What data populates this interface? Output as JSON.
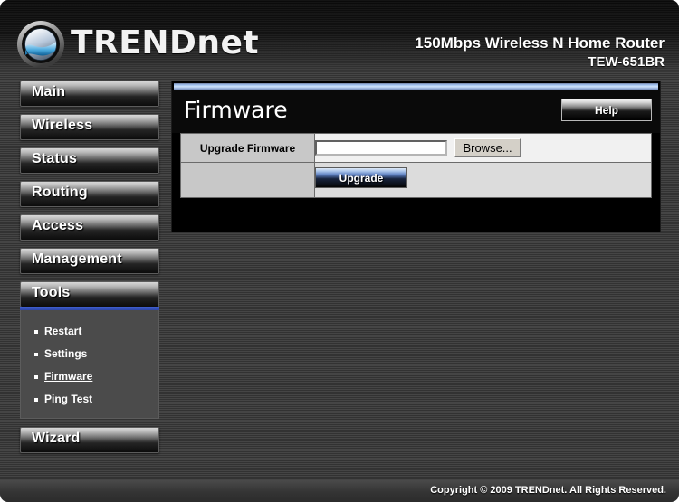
{
  "header": {
    "brand": "TRENDnet",
    "logo_icon": "trendnet-sphere-logo",
    "model_title": "150Mbps Wireless N Home Router",
    "model_number": "TEW-651BR"
  },
  "sidebar": {
    "items": [
      {
        "label": "Main",
        "active": false
      },
      {
        "label": "Wireless",
        "active": false
      },
      {
        "label": "Status",
        "active": false
      },
      {
        "label": "Routing",
        "active": false
      },
      {
        "label": "Access",
        "active": false
      },
      {
        "label": "Management",
        "active": false
      },
      {
        "label": "Tools",
        "active": true
      },
      {
        "label": "Wizard",
        "active": false
      }
    ],
    "submenu": {
      "parent": "Tools",
      "items": [
        {
          "label": "Restart",
          "current": false
        },
        {
          "label": "Settings",
          "current": false
        },
        {
          "label": "Firmware",
          "current": true
        },
        {
          "label": "Ping Test",
          "current": false
        }
      ]
    }
  },
  "content": {
    "title": "Firmware",
    "help_label": "Help",
    "form": {
      "upgrade_firmware_label": "Upgrade Firmware",
      "file_value": "",
      "file_placeholder": "",
      "browse_label": "Browse...",
      "upgrade_label": "Upgrade"
    }
  },
  "footer": {
    "copyright": "Copyright © 2009 TRENDnet. All Rights Reserved."
  },
  "colors": {
    "accent_blue": "#2e46a8",
    "panel_black": "#000000",
    "frame_gray": "#3a3a3a",
    "label_cell": "#c8c8c8"
  }
}
